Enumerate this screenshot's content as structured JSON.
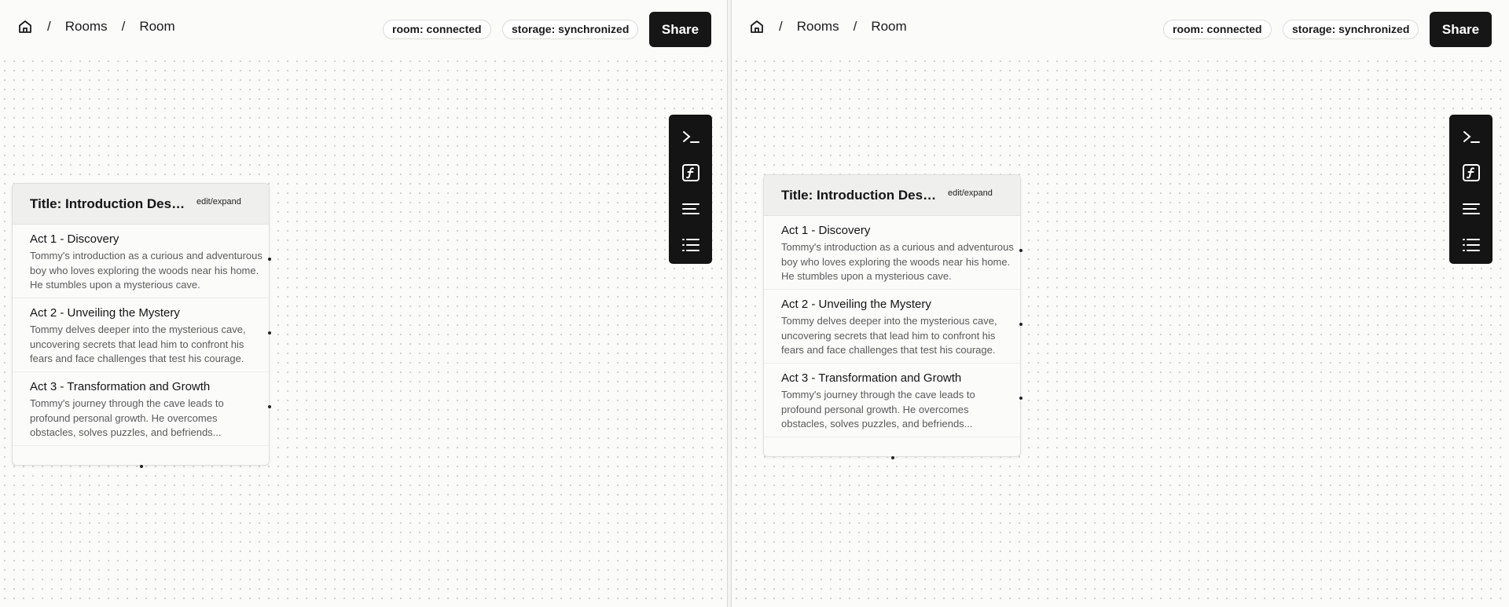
{
  "panes": [
    {
      "breadcrumb": {
        "rooms": "Rooms",
        "room": "Room",
        "separator": "/"
      },
      "status": {
        "room": "room: connected",
        "storage": "storage: synchronized"
      },
      "share_label": "Share",
      "card": {
        "title": "Title: Introduction Description",
        "edit_label": "edit/expand",
        "acts": [
          {
            "title": "Act 1 - Discovery",
            "description": "Tommy's introduction as a curious and adventurous boy who loves exploring the woods near his home. He stumbles upon a mysterious cave."
          },
          {
            "title": "Act 2 - Unveiling the Mystery",
            "description": "Tommy delves deeper into the mysterious cave, uncovering secrets that lead him to confront his fears and face challenges that test his courage."
          },
          {
            "title": "Act 3 - Transformation and Growth",
            "description": "Tommy's journey through the cave leads to profound personal growth. He overcomes obstacles, solves puzzles, and befriends..."
          }
        ]
      }
    },
    {
      "breadcrumb": {
        "rooms": "Rooms",
        "room": "Room",
        "separator": "/"
      },
      "status": {
        "room": "room: connected",
        "storage": "storage: synchronized"
      },
      "share_label": "Share",
      "card": {
        "title": "Title: Introduction Description",
        "edit_label": "edit/expand",
        "acts": [
          {
            "title": "Act 1 - Discovery",
            "description": "Tommy's introduction as a curious and adventurous boy who loves exploring the woods near his home. He stumbles upon a mysterious cave."
          },
          {
            "title": "Act 2 - Unveiling the Mystery",
            "description": "Tommy delves deeper into the mysterious cave, uncovering secrets that lead him to confront his fears and face challenges that test his courage."
          },
          {
            "title": "Act 3 - Transformation and Growth",
            "description": "Tommy's journey through the cave leads to profound personal growth. He overcomes obstacles, solves puzzles, and befriends..."
          }
        ]
      }
    }
  ],
  "toolbar_icons": [
    "terminal-icon",
    "function-icon",
    "text-align-icon",
    "list-icon"
  ],
  "colors": {
    "accent": "#161616",
    "canvas": "#fbfbfa",
    "dot": "#d2d2cc"
  }
}
